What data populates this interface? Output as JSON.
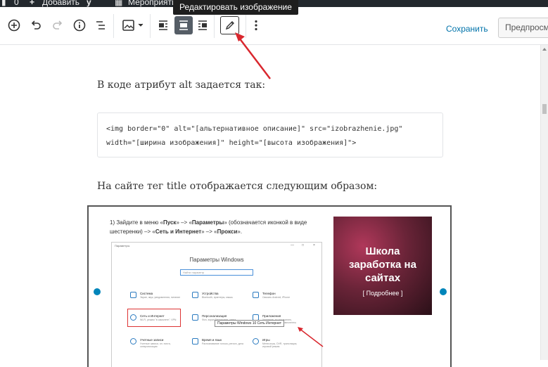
{
  "admin_bar": {
    "comments_count": "0",
    "add_label": "Добавить",
    "events_label": "Мероприяти"
  },
  "tooltip": {
    "text": "Редактировать изображение"
  },
  "toolbar": {
    "save_label": "Сохранить",
    "preview_label": "Предпросмотр"
  },
  "content": {
    "para1": "В коде атрибут alt задается так:",
    "code_line1": "<img border=\"0\" alt=\"[альтернативное описание]\" src=\"izobrazhenie.jpg\"",
    "code_line2": "width=\"[ширина изображения]\" height=\"[высота изображения]\">",
    "para2": "На сайте тег title отображается следующим образом:"
  },
  "image": {
    "instr_part1": "1) Зайдите в меню «",
    "instr_pusk": "Пуск",
    "instr_part2": "» –> «",
    "instr_params": "Параметры",
    "instr_part3": "» (обозначается иконкой в виде шестеренки) –> «",
    "instr_net": "Сеть и Интернет",
    "instr_part4": "» –> «",
    "instr_proxy": "Прокси",
    "instr_part5": "».",
    "window_title": "Параметры",
    "window_heading": "Параметры Windows",
    "window_search_placeholder": "Найти параметр",
    "tooltip_text": "Параметры Windows 10 Сеть Интернет",
    "cells": [
      {
        "title": "Система",
        "sub": "Экран, звук, уведомления, питание"
      },
      {
        "title": "Устройства",
        "sub": "Bluetooth, принтеры, мышь"
      },
      {
        "title": "Телефон",
        "sub": "Связать Android, iPhone"
      },
      {
        "title": "Сеть и Интернет",
        "sub": "Wi-Fi, режим \"в самолете\", VPN"
      },
      {
        "title": "Персонализация",
        "sub": "Фон, экран блокировки, цвета"
      },
      {
        "title": "Приложения",
        "sub": "Удаление, по умолчанию, дополнительные компоненты"
      },
      {
        "title": "Учетные записи",
        "sub": "Учетные записи, эл. почта, синхронизация"
      },
      {
        "title": "Время и язык",
        "sub": "Распознавание голоса, регион, дата"
      },
      {
        "title": "Игры",
        "sub": "Меню игры, DVR, трансляция, игровой режим"
      }
    ],
    "ad_line1": "Школа",
    "ad_line2": "заработка на",
    "ad_line3": "сайтах",
    "ad_more": "[ Подробнее ]"
  },
  "colors": {
    "accent": "#0085ba",
    "link": "#0073aa",
    "arrow": "#d9272e",
    "admin_bar": "#23282d"
  }
}
